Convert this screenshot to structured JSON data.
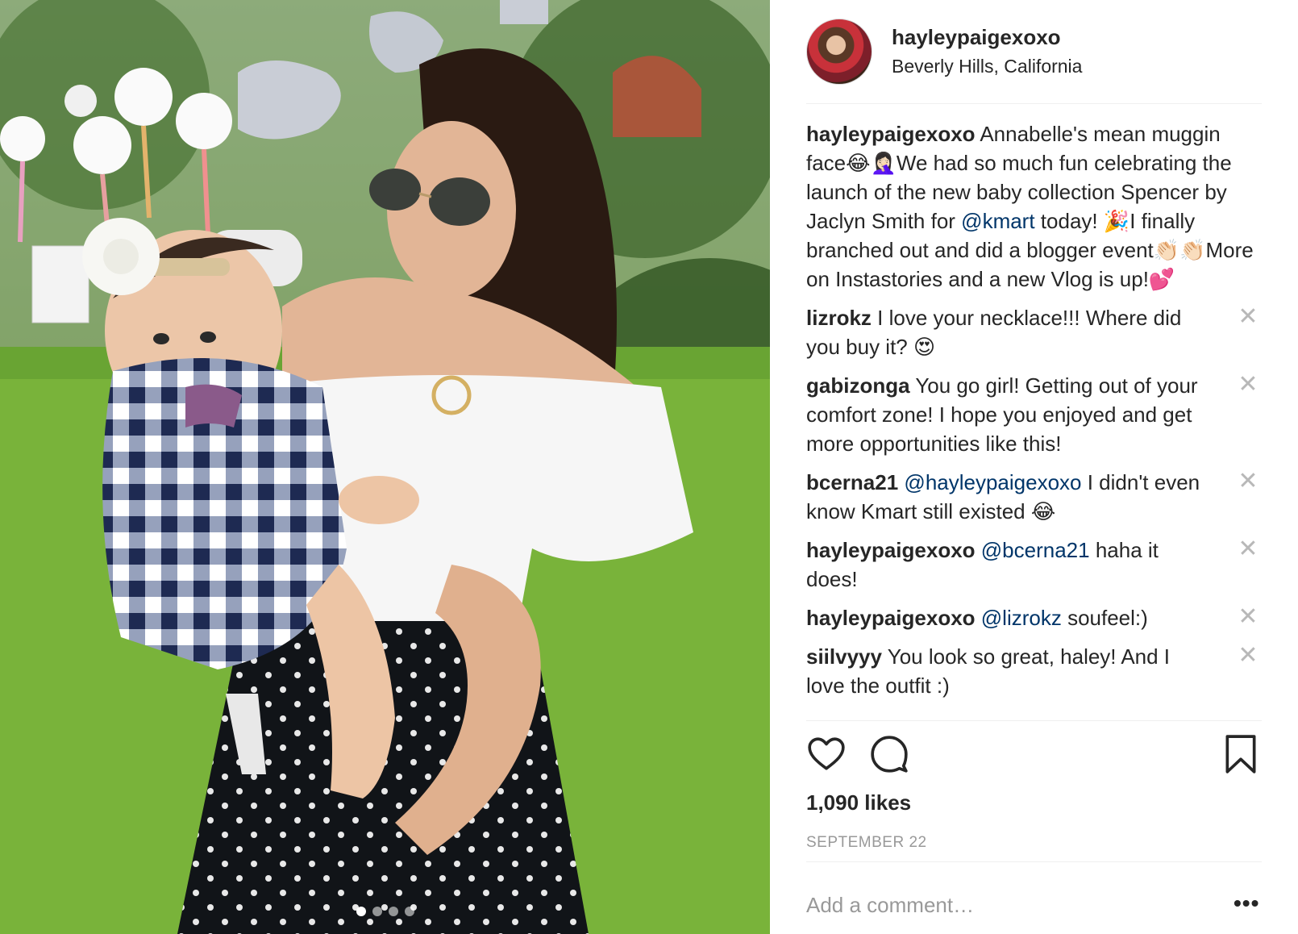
{
  "post": {
    "username": "hayleypaigexoxo",
    "location": "Beverly Hills, California",
    "caption": {
      "username": "hayleypaigexoxo",
      "text": " Annabelle's mean muggin face😂🤦🏻‍♀️We had so much fun celebrating the launch of the new baby collection Spencer by Jaclyn Smith for ",
      "mention": "@kmart",
      "text_after": " today! 🎉I finally branched out and did a blogger event👏🏻👏🏻More on Instastories and a new Vlog is up!💕"
    },
    "comments": [
      {
        "username": "lizrokz",
        "mention": "",
        "text": " I love your necklace!!! Where did you buy it? 😍"
      },
      {
        "username": "gabizonga",
        "mention": "",
        "text": " You go girl! Getting out of your comfort zone! I hope you enjoyed and get more opportunities like this!"
      },
      {
        "username": "bcerna21",
        "mention": "@hayleypaigexoxo",
        "text": " I didn't even know Kmart still existed 😂"
      },
      {
        "username": "hayleypaigexoxo",
        "mention": "@bcerna21",
        "text": " haha it does!"
      },
      {
        "username": "hayleypaigexoxo",
        "mention": "@lizrokz",
        "text": " soufeel:)"
      },
      {
        "username": "siilvyyy",
        "mention": "",
        "text": " You look so great, haley! And I love the outfit :)"
      }
    ],
    "close_symbol": "✕",
    "likes": "1,090 likes",
    "date": "SEPTEMBER 22",
    "comment_placeholder": "Add a comment…",
    "more_label": "•••",
    "carousel": {
      "count": 4,
      "active": 0
    }
  },
  "icons": {
    "like": "heart-icon",
    "comment": "comment-bubble-icon",
    "save": "bookmark-icon",
    "close": "close-icon"
  },
  "colors": {
    "text": "#262626",
    "mention": "#003569",
    "muted": "#999999",
    "divider": "#efefef"
  }
}
